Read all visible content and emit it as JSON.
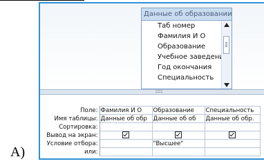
{
  "answer_label": "A)",
  "table_box": {
    "title": "Данные об образовании",
    "fields": [
      "Таб номер",
      "Фамилия И О",
      "Образование",
      "Учебное заведение",
      "Год окончания",
      "Специальность"
    ]
  },
  "splitter_glyph": "::::::::",
  "grid": {
    "row_labels": [
      "Поле:",
      "Имя таблицы:",
      "Сортировка:",
      "Вывод на экран:",
      "Условие отбора:",
      "или:"
    ],
    "columns": [
      {
        "field": "Фамилия И О",
        "table": "Данные об обр",
        "sort": "",
        "show": true,
        "criteria": "",
        "or": ""
      },
      {
        "field": "Образование",
        "table": "Данные об об",
        "sort": "",
        "show": true,
        "criteria": "\"Высшее\"",
        "or": ""
      },
      {
        "field": "Специальность",
        "table": "Данные об обр.",
        "sort": "",
        "show": true,
        "criteria": "",
        "or": ""
      }
    ]
  }
}
